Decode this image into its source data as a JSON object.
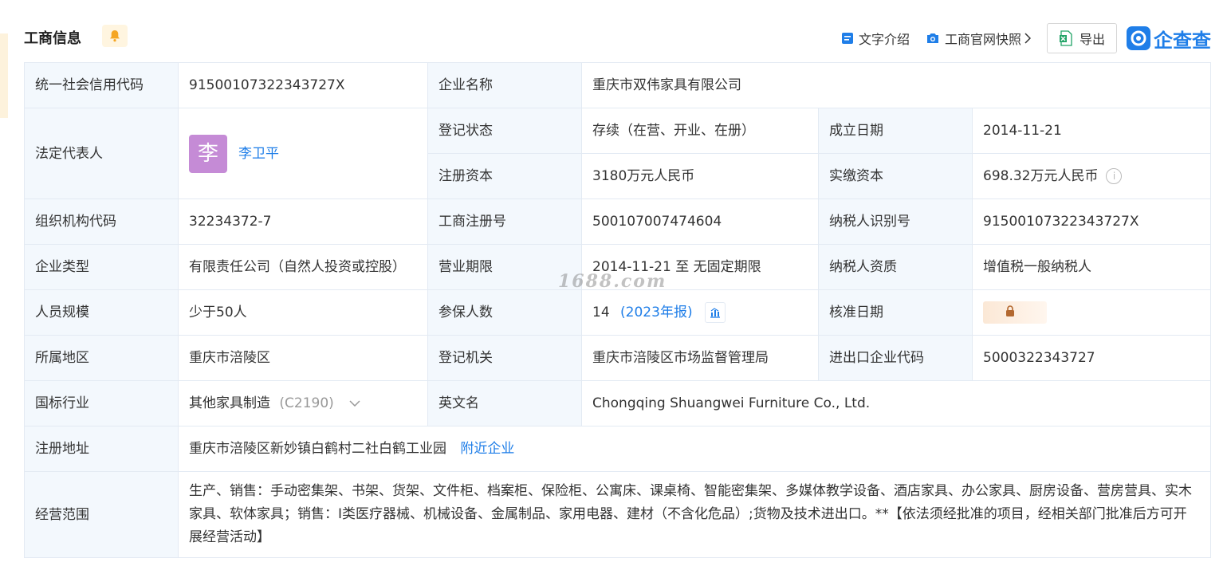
{
  "section": {
    "title": "工商信息"
  },
  "toolbar": {
    "text_intro": "文字介绍",
    "snapshot": "工商官网快照",
    "export": "导出"
  },
  "brand": {
    "logo_text": "企查查",
    "color": "#1f7ee8"
  },
  "watermark": "1688.com",
  "rows": {
    "credit_code_label": "统一社会信用代码",
    "credit_code_value": "91500107322343727X",
    "company_name_label": "企业名称",
    "company_name_value": "重庆市双伟家具有限公司",
    "legal_rep_label": "法定代表人",
    "legal_rep_avatar": "李",
    "legal_rep_name": "李卫平",
    "status_label": "登记状态",
    "status_value": "存续（在营、开业、在册）",
    "established_label": "成立日期",
    "established_value": "2014-11-21",
    "reg_capital_label": "注册资本",
    "reg_capital_value": "3180万元人民币",
    "paid_capital_label": "实缴资本",
    "paid_capital_value": "698.32万元人民币",
    "org_code_label": "组织机构代码",
    "org_code_value": "32234372-7",
    "reg_no_label": "工商注册号",
    "reg_no_value": "500107007474604",
    "taxpayer_id_label": "纳税人识别号",
    "taxpayer_id_value": "91500107322343727X",
    "type_label": "企业类型",
    "type_value": "有限责任公司（自然人投资或控股）",
    "term_label": "营业期限",
    "term_value": "2014-11-21 至 无固定期限",
    "tax_quality_label": "纳税人资质",
    "tax_quality_value": "增值税一般纳税人",
    "staff_label": "人员规模",
    "staff_value": "少于50人",
    "insured_label": "参保人数",
    "insured_value": "14",
    "insured_year": "(2023年报)",
    "approved_label": "核准日期",
    "region_label": "所属地区",
    "region_value": "重庆市涪陵区",
    "authority_label": "登记机关",
    "authority_value": "重庆市涪陵区市场监督管理局",
    "import_export_label": "进出口企业代码",
    "import_export_value": "5000322343727",
    "industry_label": "国标行业",
    "industry_value": "其他家具制造",
    "industry_code": "(C2190)",
    "english_label": "英文名",
    "english_value": "Chongqing Shuangwei Furniture Co., Ltd.",
    "address_label": "注册地址",
    "address_value": "重庆市涪陵区新妙镇白鹤村二社白鹤工业园",
    "address_link": "附近企业",
    "scope_label": "经营范围",
    "scope_value": "生产、销售：手动密集架、书架、货架、文件柜、档案柜、保险柜、公寓床、课桌椅、智能密集架、多媒体教学设备、酒店家具、办公家具、厨房设备、营房营具、实木家具、软体家具；销售：Ⅰ类医疗器械、机械设备、金属制品、家用电器、建材（不含化危品）;货物及技术进出口。**【依法须经批准的项目，经相关部门批准后方可开展经营活动】"
  }
}
